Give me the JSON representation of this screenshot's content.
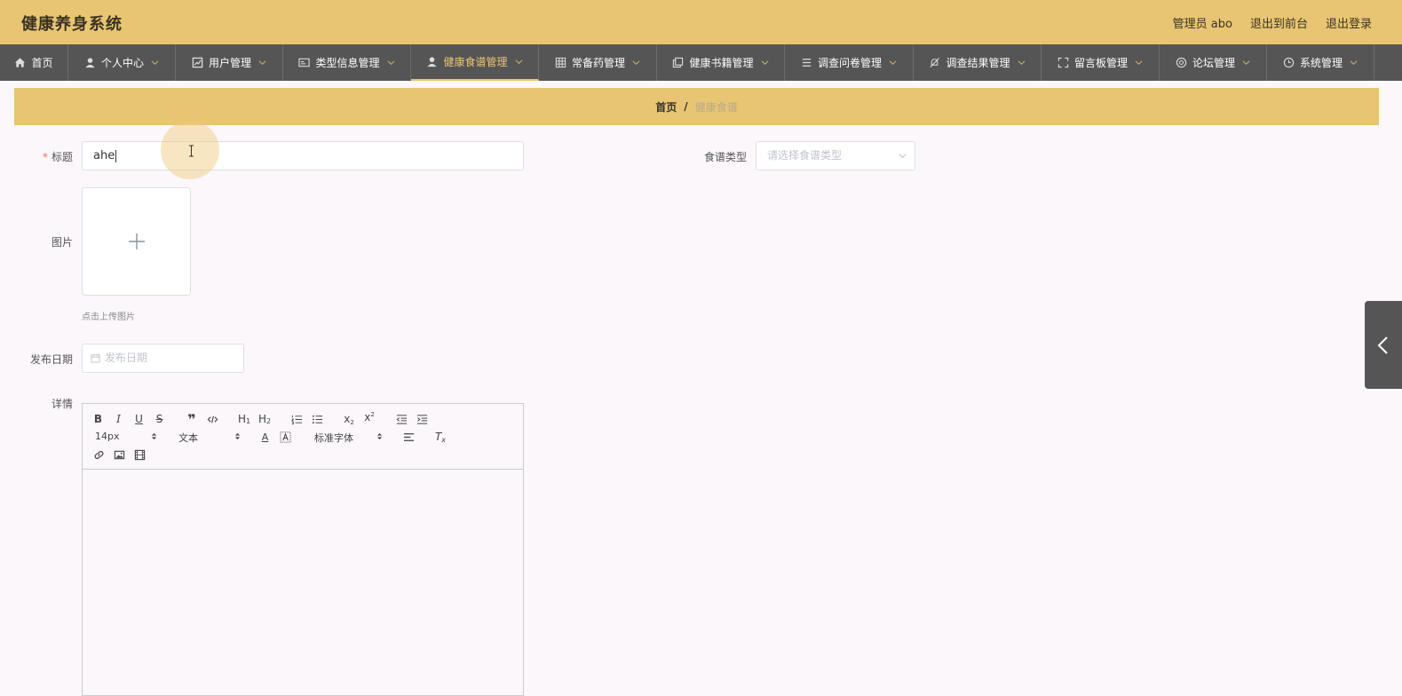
{
  "header": {
    "app_title": "健康养身系统",
    "links": [
      "管理员 abo",
      "退出到前台",
      "退出登录"
    ]
  },
  "nav": {
    "items": [
      {
        "label": "首页",
        "icon": "home-icon",
        "has_dropdown": false,
        "active": false
      },
      {
        "label": "个人中心",
        "icon": "user-icon",
        "has_dropdown": true,
        "active": false
      },
      {
        "label": "用户管理",
        "icon": "chart-icon",
        "has_dropdown": true,
        "active": false
      },
      {
        "label": "类型信息管理",
        "icon": "id-card-icon",
        "has_dropdown": true,
        "active": false
      },
      {
        "label": "健康食谱管理",
        "icon": "user-icon",
        "has_dropdown": true,
        "active": true
      },
      {
        "label": "常备药管理",
        "icon": "grid-icon",
        "has_dropdown": true,
        "active": false
      },
      {
        "label": "健康书籍管理",
        "icon": "copy-icon",
        "has_dropdown": true,
        "active": false
      },
      {
        "label": "调查问卷管理",
        "icon": "list-icon",
        "has_dropdown": true,
        "active": false
      },
      {
        "label": "调查结果管理",
        "icon": "bell-off-icon",
        "has_dropdown": true,
        "active": false
      },
      {
        "label": "留言板管理",
        "icon": "fullscreen-icon",
        "has_dropdown": true,
        "active": false
      },
      {
        "label": "论坛管理",
        "icon": "forum-icon",
        "has_dropdown": true,
        "active": false
      },
      {
        "label": "系统管理",
        "icon": "clock-icon",
        "has_dropdown": true,
        "active": false
      }
    ]
  },
  "breadcrumb": {
    "home": "首页",
    "separator": "/",
    "current": "健康食谱"
  },
  "form": {
    "title_label": "标题",
    "title_required_mark": "*",
    "title_value": "ahe",
    "recipe_type_label": "食谱类型",
    "recipe_type_placeholder": "请选择食谱类型",
    "image_label": "图片",
    "upload_hint": "点击上传图片",
    "date_label": "发布日期",
    "date_placeholder": "发布日期",
    "detail_label": "详情"
  },
  "editor": {
    "font_size": "14px",
    "block_format": "文本",
    "font_family": "标准字体"
  },
  "colors": {
    "header_bg": "#e8c572",
    "nav_bg": "#555555",
    "nav_active_text": "#e8c572",
    "page_bg": "#fbf7fa",
    "required": "#f56c6c"
  }
}
